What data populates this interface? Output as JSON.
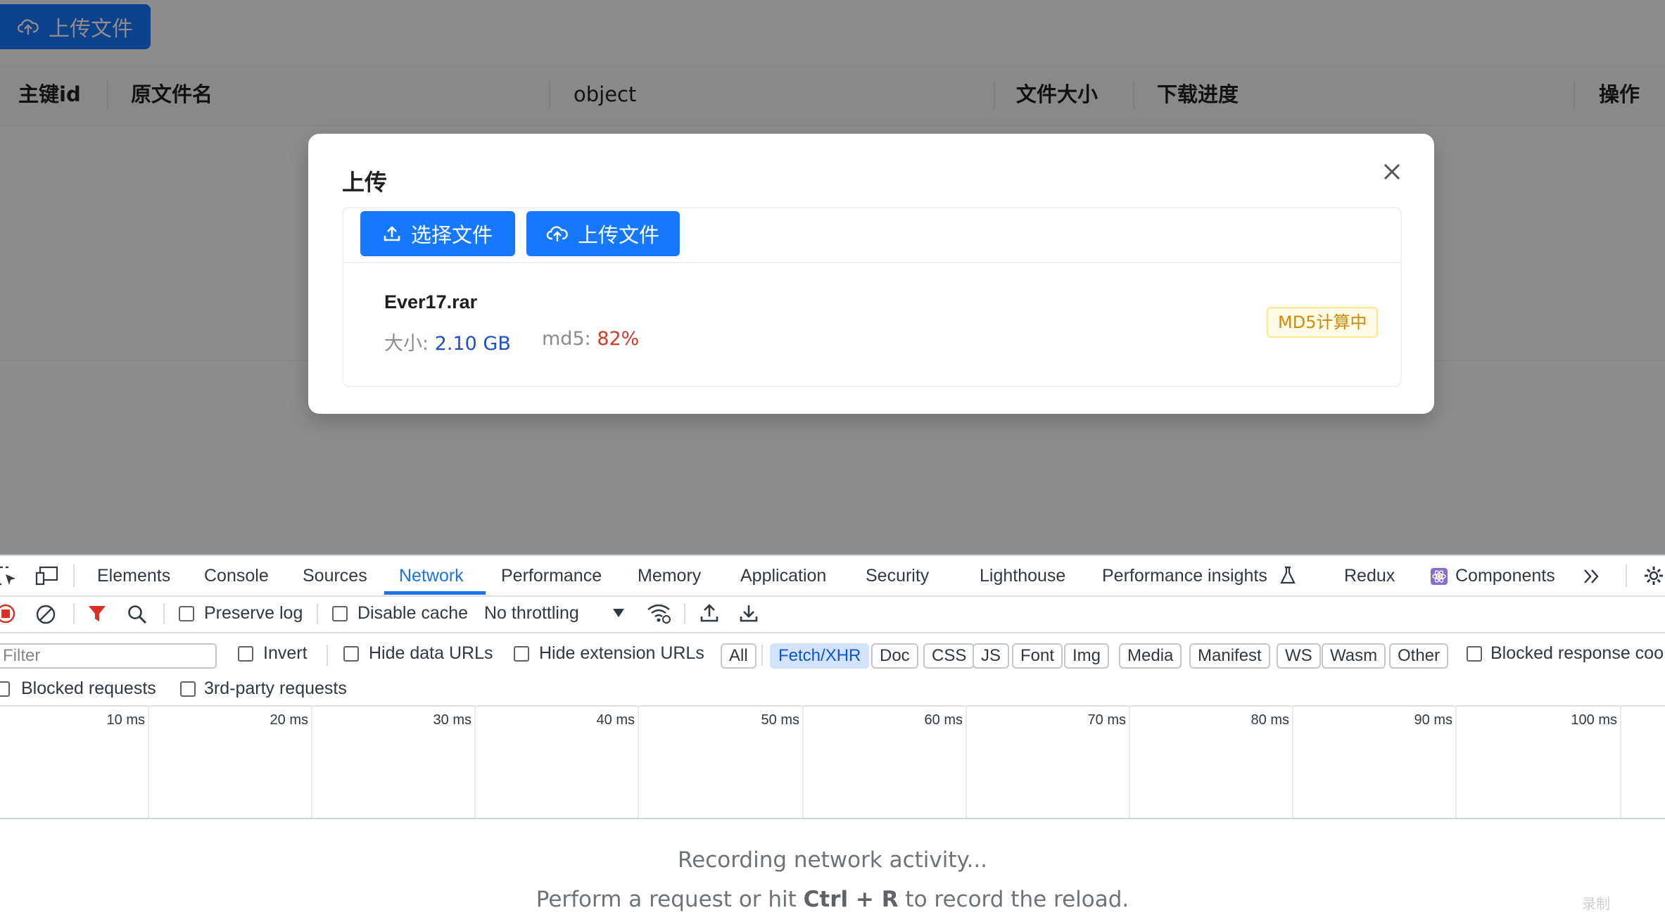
{
  "app": {
    "top_upload_label": "上传文件",
    "table_headers": [
      "主键id",
      "原文件名",
      "object",
      "文件大小",
      "下载进度",
      "操作"
    ]
  },
  "modal": {
    "title": "上传",
    "select_button": "选择文件",
    "upload_button": "上传文件",
    "file": {
      "name": "Ever17.rar",
      "size_label": "大小:",
      "size_value": "2.10 GB",
      "md5_label": "md5:",
      "md5_value": "82%",
      "status_tag": "MD5计算中"
    }
  },
  "devtools": {
    "tabs": [
      "Elements",
      "Console",
      "Sources",
      "Network",
      "Performance",
      "Memory",
      "Application",
      "Security",
      "Lighthouse",
      "Performance insights",
      "Redux",
      "Components"
    ],
    "active_tab": "Network",
    "toolbar": {
      "preserve_log": "Preserve log",
      "disable_cache": "Disable cache",
      "throttling": "No throttling"
    },
    "filter": {
      "placeholder": "Filter",
      "invert": "Invert",
      "hide_data_urls": "Hide data URLs",
      "hide_extension_urls": "Hide extension URLs",
      "types": [
        "All",
        "Fetch/XHR",
        "Doc",
        "CSS",
        "JS",
        "Font",
        "Img",
        "Media",
        "Manifest",
        "WS",
        "Wasm",
        "Other"
      ],
      "active_type": "Fetch/XHR",
      "blocked_response": "Blocked response coo",
      "blocked_requests": "Blocked requests",
      "third_party": "3rd-party requests"
    },
    "timeline_ticks": [
      "10 ms",
      "20 ms",
      "30 ms",
      "40 ms",
      "50 ms",
      "60 ms",
      "70 ms",
      "80 ms",
      "90 ms",
      "100 ms"
    ],
    "empty": {
      "line1": "Recording network activity...",
      "line2_pre": "Perform a request or hit ",
      "line2_keys": "Ctrl + R",
      "line2_post": " to record the reload."
    },
    "watermark": "录制"
  }
}
